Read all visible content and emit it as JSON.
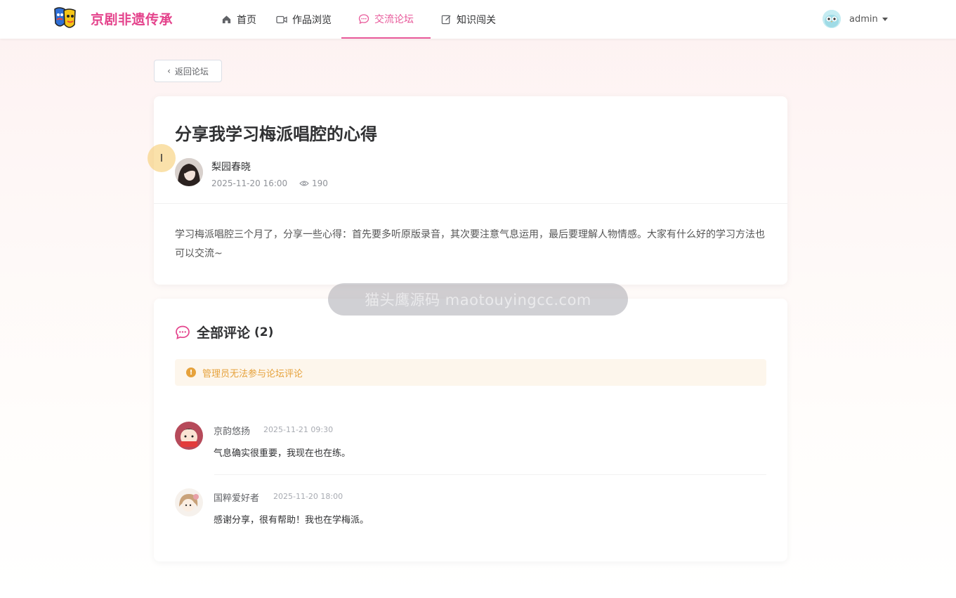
{
  "brand": {
    "name": "京剧非遗传承",
    "logo_icon": "opera-mask-icon"
  },
  "nav": {
    "items": [
      {
        "label": "首页",
        "icon": "home-icon"
      },
      {
        "label": "作品浏览",
        "icon": "video-icon"
      },
      {
        "label": "交流论坛",
        "icon": "chat-bubble-icon",
        "active": true
      },
      {
        "label": "知识闯关",
        "icon": "edit-icon"
      }
    ]
  },
  "user": {
    "name": "admin"
  },
  "back_button": {
    "label": "返回论坛"
  },
  "post": {
    "title": "分享我学习梅派唱腔的心得",
    "author": "梨园春晓",
    "date": "2025-11-20 16:00",
    "views": "190",
    "content": "学习梅派唱腔三个月了，分享一些心得：首先要多听原版录音，其次要注意气息运用，最后要理解人物情感。大家有什么好的学习方法也可以交流~"
  },
  "comments_section": {
    "title": "全部评论",
    "count": "(2)",
    "notice": "管理员无法参与论坛评论",
    "items": [
      {
        "user": "京韵悠扬",
        "time": "2025-11-21 09:30",
        "text": "气息确实很重要，我现在也在练。"
      },
      {
        "user": "国粹爱好者",
        "time": "2025-11-20 18:00",
        "text": "感谢分享，很有帮助！我也在学梅派。"
      }
    ]
  },
  "watermark": {
    "text": "猫头鹰源码 maotouyingcc.com"
  },
  "colors": {
    "accent": "#e85a9b",
    "brand": "#e4438c",
    "warning": "#e6a23c"
  }
}
